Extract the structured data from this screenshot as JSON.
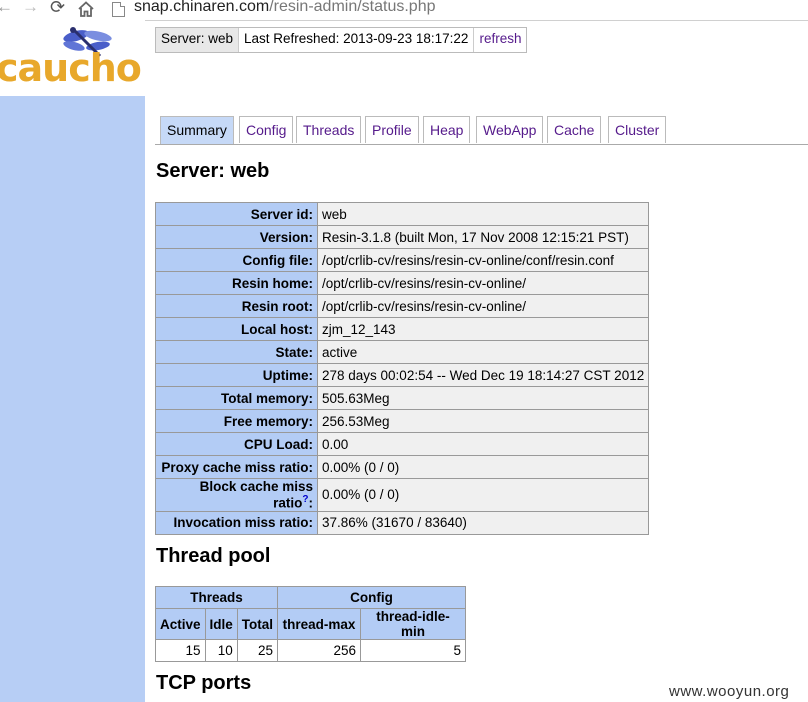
{
  "browser": {
    "url_host": "snap.chinaren.com",
    "url_path": "/resin-admin/status.php"
  },
  "logo": {
    "text": "caucho"
  },
  "statusbar": {
    "server": "Server: web",
    "last_refreshed": "Last Refreshed: 2013-09-23 18:17:22",
    "refresh": "refresh"
  },
  "tabs": [
    {
      "label": "Summary",
      "active": true
    },
    {
      "label": "Config"
    },
    {
      "label": "Threads"
    },
    {
      "label": "Profile"
    },
    {
      "label": "Heap"
    },
    {
      "label": "WebApp"
    },
    {
      "label": "Cache"
    },
    {
      "label": "Cluster"
    }
  ],
  "server_heading": "Server: web",
  "server_info": [
    {
      "key": "Server id:",
      "value": "web"
    },
    {
      "key": "Version:",
      "value": "Resin-3.1.8 (built Mon, 17 Nov 2008 12:15:21 PST)"
    },
    {
      "key": "Config file:",
      "value": "/opt/crlib-cv/resins/resin-cv-online/conf/resin.conf"
    },
    {
      "key": "Resin home:",
      "value": "/opt/crlib-cv/resins/resin-cv-online/"
    },
    {
      "key": "Resin root:",
      "value": "/opt/crlib-cv/resins/resin-cv-online/"
    },
    {
      "key": "Local host:",
      "value": "zjm_12_143"
    },
    {
      "key": "State:",
      "value": "active"
    },
    {
      "key": "Uptime:",
      "value": "278 days 00:02:54 -- Wed Dec 19 18:14:27 CST 2012"
    },
    {
      "key": "Total memory:",
      "value": "505.63Meg"
    },
    {
      "key": "Free memory:",
      "value": "256.53Meg"
    },
    {
      "key": "CPU Load:",
      "value": "0.00"
    },
    {
      "key": "Proxy cache miss ratio:",
      "value": "0.00% (0 / 0)"
    },
    {
      "key": "Block cache miss ratio",
      "help": "?",
      "value": "0.00% (0 / 0)"
    },
    {
      "key": "Invocation miss ratio:",
      "value": "37.86% (31670 / 83640)"
    }
  ],
  "thread_pool": {
    "heading": "Thread pool",
    "group_headers": [
      "Threads",
      "Config"
    ],
    "columns": [
      "Active",
      "Idle",
      "Total",
      "thread-max",
      "thread-idle-min"
    ],
    "row": [
      "15",
      "10",
      "25",
      "256",
      "5"
    ]
  },
  "tcp_heading": "TCP ports",
  "watermark": "www.wooyun.org",
  "colors": {
    "sidebar": "#b7cef5",
    "table_header": "#b3ccf5",
    "logo": "#e8a82b",
    "link": "#551a8b"
  }
}
